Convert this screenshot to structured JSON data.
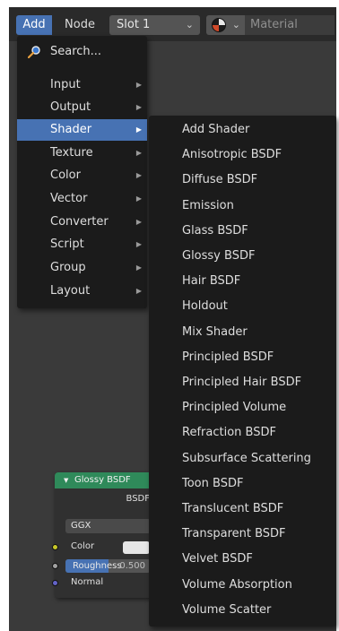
{
  "header": {
    "add_label": "Add",
    "node_label": "Node",
    "slot_label": "Slot 1",
    "material_label": "Material"
  },
  "add_menu": {
    "search_label": "Search...",
    "items": [
      {
        "label": "Input"
      },
      {
        "label": "Output"
      },
      {
        "label": "Shader"
      },
      {
        "label": "Texture"
      },
      {
        "label": "Color"
      },
      {
        "label": "Vector"
      },
      {
        "label": "Converter"
      },
      {
        "label": "Script"
      },
      {
        "label": "Group"
      },
      {
        "label": "Layout"
      }
    ],
    "active_item": "Shader"
  },
  "shader_menu": {
    "items": [
      "Add Shader",
      "Anisotropic BSDF",
      "Diffuse BSDF",
      "Emission",
      "Glass BSDF",
      "Glossy BSDF",
      "Hair BSDF",
      "Holdout",
      "Mix Shader",
      "Principled BSDF",
      "Principled Hair BSDF",
      "Principled Volume",
      "Refraction BSDF",
      "Subsurface Scattering",
      "Toon BSDF",
      "Translucent BSDF",
      "Transparent BSDF",
      "Velvet BSDF",
      "Volume Absorption",
      "Volume Scatter"
    ]
  },
  "node": {
    "title": "Glossy BSDF",
    "output_label": "BSDF",
    "distribution": "GGX",
    "inputs": {
      "color_label": "Color",
      "roughness_label": "Roughness",
      "roughness_value": "0.500",
      "normal_label": "Normal"
    },
    "roughness_fraction": 0.5
  },
  "colors": {
    "accent": "#4772b3",
    "menu_bg": "#1b1b1b",
    "node_header": "#2f8a5a",
    "socket_color": "#c7c729",
    "socket_float": "#a1a1a1",
    "socket_vector": "#6363c7"
  }
}
